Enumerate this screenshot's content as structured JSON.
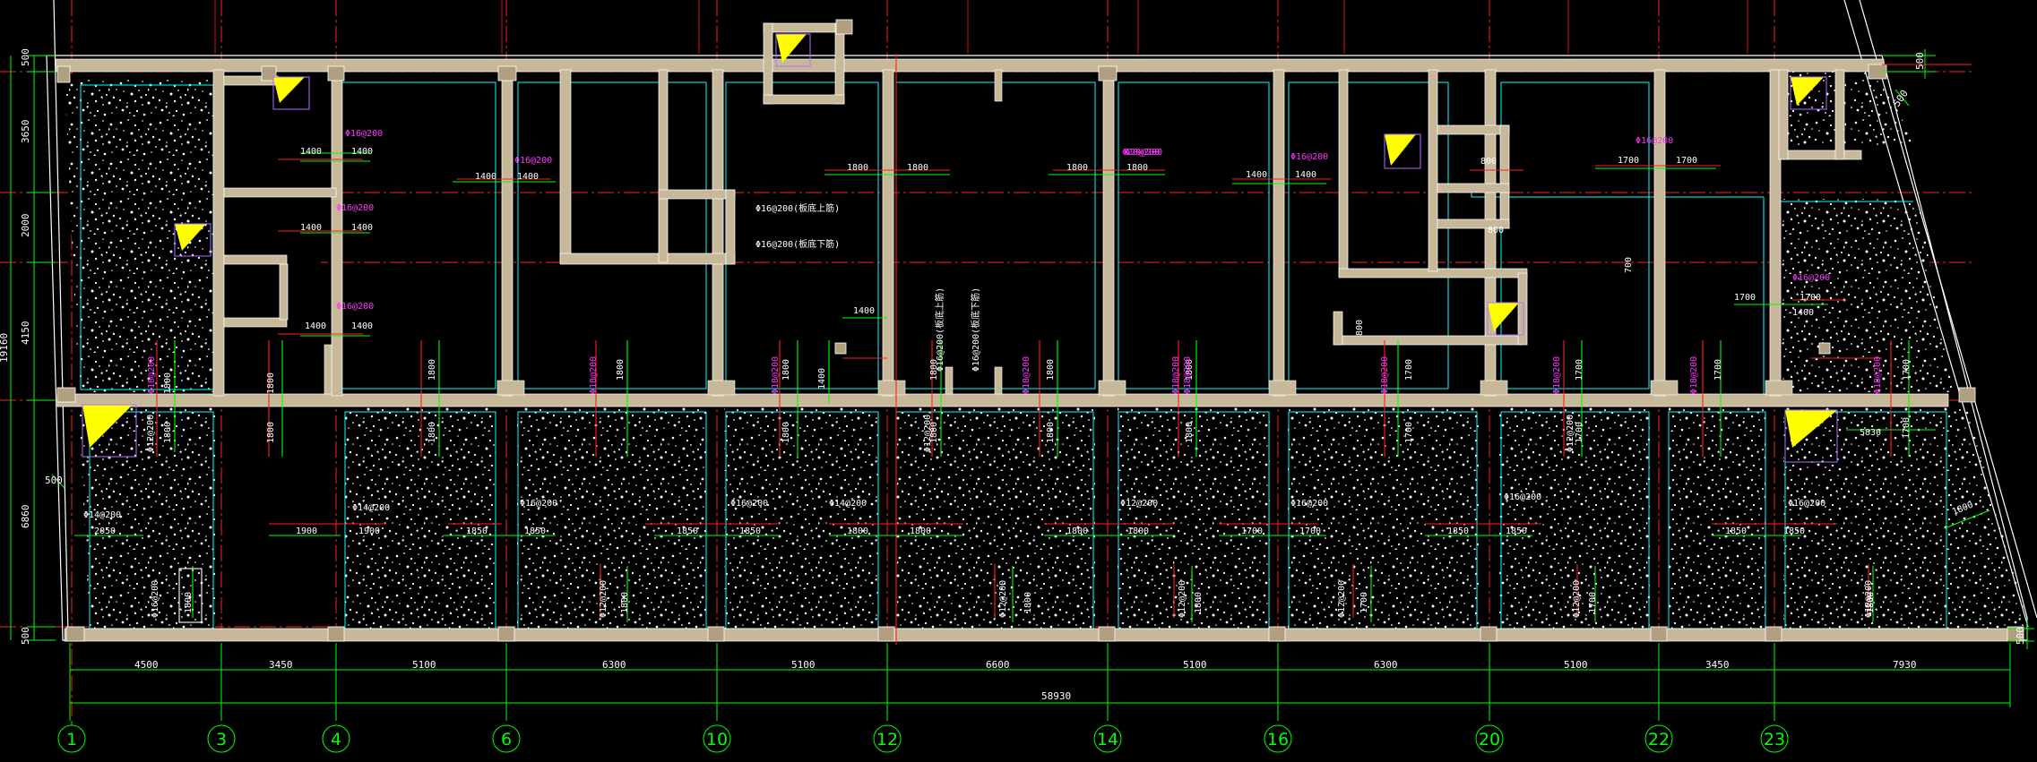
{
  "axes": [
    {
      "id": "axis-1",
      "label": "1"
    },
    {
      "id": "axis-3",
      "label": "3"
    },
    {
      "id": "axis-4",
      "label": "4"
    },
    {
      "id": "axis-6",
      "label": "6"
    },
    {
      "id": "axis-10",
      "label": "10"
    },
    {
      "id": "axis-12",
      "label": "12"
    },
    {
      "id": "axis-14",
      "label": "14"
    },
    {
      "id": "axis-16",
      "label": "16"
    },
    {
      "id": "axis-20",
      "label": "20"
    },
    {
      "id": "axis-22",
      "label": "22"
    },
    {
      "id": "axis-23",
      "label": "23"
    }
  ],
  "bottom_dims": [
    "4500",
    "3450",
    "5100",
    "6300",
    "5100",
    "6600",
    "5100",
    "6300",
    "5100",
    "3450",
    "7930"
  ],
  "total_dim": "58930",
  "left_dims": [
    "500",
    "3650",
    "2000",
    "4150",
    "6860",
    "500"
  ],
  "left_outer_dim": "19160",
  "left_small_dim": "500",
  "right_dims": {
    "top": "500",
    "diag": "500",
    "bottom": "500"
  },
  "rebar_labels": {
    "r1": "Φ16@200",
    "r2": "Φ16@200",
    "r3": "Φ16@200",
    "r4": "Φ20@200",
    "r5": "Φ20@200",
    "r6": "Φ16@200",
    "r7": "Φ16@200",
    "r8": "Φ16@200",
    "r9": "Φ16@200",
    "r10": "Φ16@200(板底上筋)",
    "r11": "Φ16@200(板底下筋)",
    "r12": "Φ14@200",
    "r13": "Φ14@200",
    "r14": "Φ16@200",
    "r15": "Φ16@200",
    "r16": "Φ14@200",
    "r17": "Φ12@200",
    "r18": "Φ12@200",
    "r19": "Φ16@200",
    "r20": "Φ16@200",
    "r21": "Φ16@200",
    "r22": "Φ12@200",
    "r23": "Φ16@200",
    "r24": "Φ16@200",
    "r25": "Φ16@200",
    "r26": "Φ16@200(板底上筋)",
    "r27": "Φ16@200(板底下筋)",
    "r28": "Φ16@200",
    "r29": "Φ16@200",
    "r30": "Φ16@200"
  },
  "spans": {
    "s1": "1400",
    "s2": "1400",
    "s3": "1400",
    "s4": "1400",
    "s5": "1400",
    "s6": "1400",
    "s7": "1400",
    "s8": "1400",
    "s9": "1800",
    "s10": "1800",
    "s11": "1800",
    "s12": "1800",
    "s13": "1400",
    "s14": "1400",
    "s15": "800",
    "s16": "1700",
    "s17": "1700",
    "s18": "1700",
    "s19": "1700",
    "s20": "1400",
    "s21": "1400",
    "s22": "2050",
    "s23": "1900",
    "s24": "1900",
    "s25": "1850",
    "s26": "1850",
    "s27": "1850",
    "s28": "1850",
    "s29": "1800",
    "s30": "1800",
    "s31": "1800",
    "s32": "1800",
    "s33": "1700",
    "s34": "1700",
    "s35": "1850",
    "s36": "1850",
    "s37": "1850",
    "s38": "1850",
    "s39": "5830",
    "s40": "1800",
    "s41": "800",
    "s42": "800",
    "s43": "700"
  },
  "vert_spans": {
    "v1": "1800",
    "v2": "1800",
    "v3": "1800",
    "v4": "1800",
    "v5": "1800",
    "v6": "1400",
    "v7": "1800",
    "v8": "1800",
    "v9": "1700",
    "v10": "1700",
    "v11": "1700",
    "v12": "1700",
    "v13": "1700",
    "v14": "1800",
    "v15": "1800",
    "v16": "1800",
    "v17": "1800",
    "v18": "1800",
    "v19": "1800",
    "v20": "1800",
    "v21": "1700",
    "v22": "1700",
    "v23": "1800",
    "v24": "1800",
    "v25": "1800",
    "v26": "1700",
    "v27": "1800",
    "v28": "1700",
    "v29": "1800",
    "v30": "1800",
    "v31": "1800",
    "v32": "1800",
    "v33": "1700",
    "v34": "1800",
    "v35": "1800",
    "v36": "1800"
  },
  "vert_rebar": {
    "vr1": "Φ18@200",
    "vr2": "Φ18@200",
    "vr3": "Φ18@200",
    "vr4": "Φ18@200",
    "vr5": "Φ18@200",
    "vr6": "Φ18@200",
    "vr7": "Φ18@200",
    "vr8": "Φ18@200",
    "vr9": "Φ18@200",
    "vr10": "Φ18@200",
    "vr11": "Φ16@200(板底上筋)",
    "vr12": "Φ16@200(板底下筋)",
    "vr13": "Φ16@200",
    "vr14": "Φ12@200",
    "vr15": "Φ12@200",
    "vr16": "Φ12@200",
    "vr17": "Φ12@200",
    "vr18": "Φ12@200",
    "vr19": "Φ12@200",
    "vr20": "Φ12@200",
    "vr21": "Φ12@200",
    "vr22": "Φ12@200"
  },
  "colors": {
    "background": "#000000",
    "wall_fill": "#c8b89a",
    "wall_edge": "#ffffff",
    "inner_line": "#00ffff",
    "grid_red": "#ff2020",
    "dim_green": "#00ff00",
    "rebar_magenta": "#ff33ff",
    "marker_yellow": "#ffff00",
    "marker_box": "#b070ff"
  }
}
